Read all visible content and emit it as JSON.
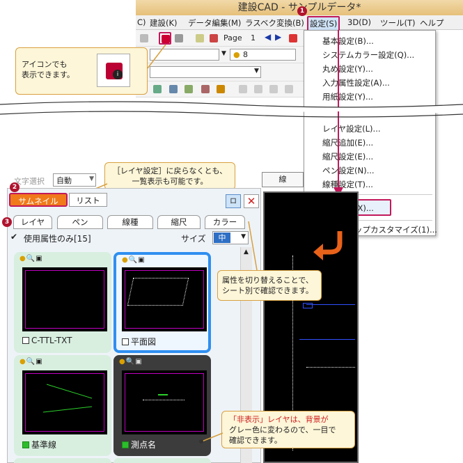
{
  "app": {
    "title": "建設CAD - サンプルデータ*"
  },
  "menu": [
    "C)",
    "建設(K)",
    "データ編集(M)",
    "ラスベク変換(B)",
    "設定(S)",
    "3D(D)",
    "ツール(T)",
    "ヘルプ"
  ],
  "toolbar": {
    "page_label": "Page",
    "page_num": "1",
    "layer_num": "8"
  },
  "settings_menu": {
    "items_top": [
      "基本設定(B)...",
      "システムカラー設定(Q)...",
      "丸め設定(Y)...",
      "入力属性設定(A)...",
      "用紙設定(Y)..."
    ],
    "items_bottom": [
      "レイヤ設定(L)...",
      "縮尺追加(E)...",
      "縮尺設定(E)...",
      "ペン設定(N)...",
      "線種設定(T)..."
    ],
    "highlighted": "形状表示(X)...",
    "last": "ポップアップカスタマイズ(1)..."
  },
  "callouts": {
    "icon_line1": "アイコンでも",
    "icon_line2": "表示できます。",
    "layer_line1": "［レイヤ設定］に戻らなくとも、",
    "layer_line2": "一覧表示も可能です。",
    "attr_line1": "属性を切り替えることで、",
    "attr_line2": "シート別で確認できます。",
    "hidden_line1": "「非表示」レイヤは、背景が",
    "hidden_line2": "グレー色に変わるので、一目で",
    "hidden_line3": "確認できます。"
  },
  "badges": [
    "1",
    "2",
    "3"
  ],
  "panel": {
    "select_label": "文字選択",
    "select_value": "自動",
    "tabs": {
      "thumbnail": "サムネイル",
      "list": "リスト"
    },
    "attr_tabs": [
      "レイヤ",
      "ペン",
      "線種",
      "縮尺",
      "カラー"
    ],
    "use_attr_only": "使用属性のみ[15]",
    "size_label": "サイズ",
    "size_value": "中",
    "pin": "ロ",
    "line_btn": "線",
    "thumbnails": [
      {
        "label": "C-TTL-TXT",
        "checked": false
      },
      {
        "label": "平面図",
        "checked": false
      },
      {
        "label": "基準線",
        "checked": true
      },
      {
        "label": "測点名",
        "checked": true
      }
    ]
  },
  "colors": {
    "accent_orange": "#f07a1a",
    "badge_red": "#b0132e",
    "highlight_magenta": "#c2185b"
  }
}
